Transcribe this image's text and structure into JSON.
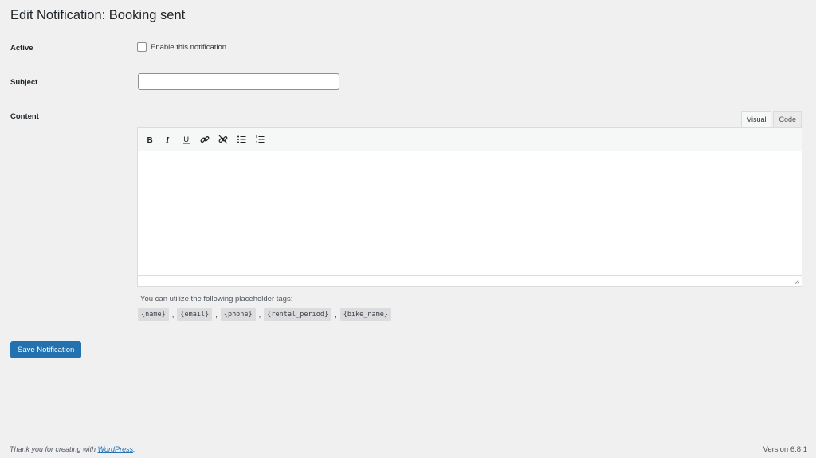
{
  "page": {
    "title": "Edit Notification: Booking sent"
  },
  "form": {
    "active_label": "Active",
    "active_checkbox_label": "Enable this notification",
    "active_checked": false,
    "subject_label": "Subject",
    "subject_value": "",
    "content_label": "Content"
  },
  "editor": {
    "tabs": [
      "Visual",
      "Code"
    ],
    "active_tab": "Visual",
    "toolbar_icons": [
      "bold-icon",
      "italic-icon",
      "underline-icon",
      "link-icon",
      "unlink-icon",
      "bulleted-list-icon",
      "numbered-list-icon"
    ],
    "content": ""
  },
  "placeholders": {
    "intro": "You can utilize the following placeholder tags:",
    "tags": [
      "{name}",
      "{email}",
      "{phone}",
      "{rental_period}",
      "{bike_name}"
    ],
    "separator": ","
  },
  "actions": {
    "save_label": "Save Notification",
    "save_color": "#2271b1"
  },
  "footer": {
    "thanks_prefix": "Thank you for creating with ",
    "thanks_link": "WordPress",
    "thanks_suffix": ".",
    "version": "Version 6.8.1"
  }
}
